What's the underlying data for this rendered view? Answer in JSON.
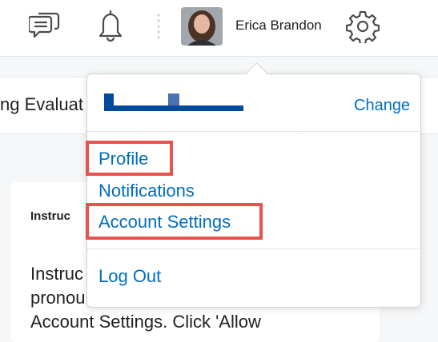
{
  "header": {
    "user_name": "Erica Brandon",
    "icons": [
      "message-alerts-icon",
      "notifications-bell-icon",
      "settings-gear-icon"
    ]
  },
  "background": {
    "page_title_partial": "ng Evaluat",
    "card_heading_partial": "Instruc",
    "card_text_line1_partial": "Instruc",
    "card_text_line2": "pronouns in Brightspace under",
    "card_text_line3": "Account Settings. Click 'Allow"
  },
  "dropdown": {
    "change_label": "Change",
    "menu_items": [
      {
        "label": "Profile",
        "highlighted": true
      },
      {
        "label": "Notifications",
        "highlighted": false
      },
      {
        "label": "Account Settings",
        "highlighted": true
      }
    ],
    "logout_label": "Log Out"
  },
  "colors": {
    "link": "#006fbf",
    "highlight": "#e9534d",
    "redaction": "#004a9c"
  }
}
